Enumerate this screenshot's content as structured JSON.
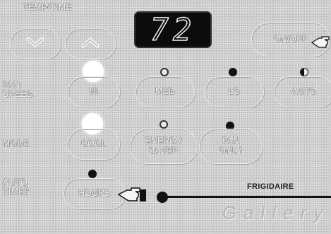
{
  "labels": {
    "temp_time": "TEMP/TIME",
    "fan_speed": "FAN\nSPEED",
    "mode": "MODE",
    "auto_timer": "AUTO\nTIMER"
  },
  "display": {
    "value": "72"
  },
  "buttons": {
    "power": "ON/OFF",
    "hi": "HI",
    "med": "MED",
    "lo": "LO",
    "auto": "AUTO",
    "cool": "COOL",
    "energy_saver": "ENERGY\nSAVER",
    "fan_only": "FAN\nONLY",
    "hours": "HOURS"
  },
  "icons": {
    "down": "chevron-down-icon",
    "up": "chevron-up-icon",
    "pointer": "pointing-hand-icon"
  },
  "brand": "FRIGIDAIRE",
  "brand_script": "Gallery",
  "colors": {
    "panel": "#cfcfcf",
    "led_on": "#ffffff",
    "led_off": "#111111",
    "display_bg": "#0c0c0c"
  }
}
